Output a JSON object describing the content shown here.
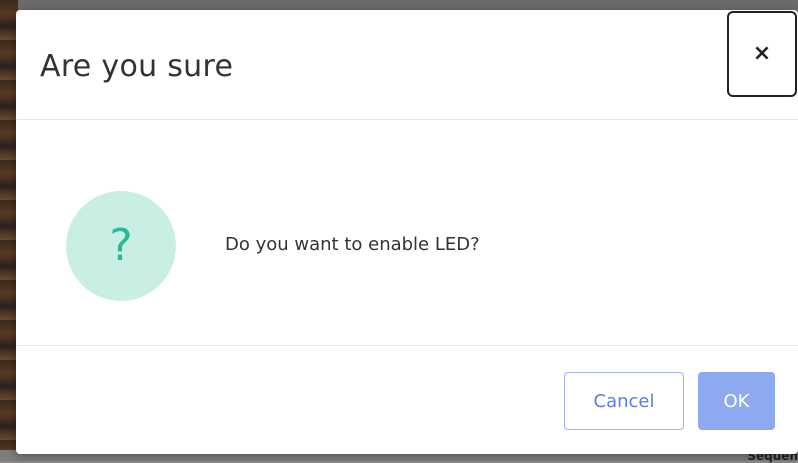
{
  "dialog": {
    "title": "Are you sure",
    "close_label": "×",
    "message": "Do you want to enable LED?",
    "icon": "question-icon",
    "icon_glyph": "?",
    "accent_color": "#2bb89a",
    "icon_bg_color": "#c9efe5"
  },
  "footer": {
    "cancel_label": "Cancel",
    "ok_label": "OK",
    "primary_color": "#8da9f2"
  },
  "background": {
    "partial_text": "Sequen"
  }
}
